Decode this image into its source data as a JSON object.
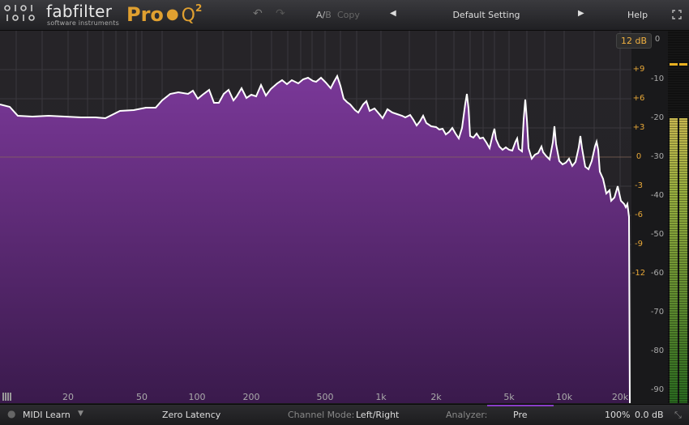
{
  "header": {
    "brand": "fabfilter",
    "brand_sub": "software instruments",
    "product": "Pro",
    "product_q": "Q",
    "product_version": "2",
    "ab_a": "A/",
    "ab_b": "B",
    "copy": "Copy",
    "preset_name": "Default Setting",
    "help": "Help",
    "undo_icon": "undo-icon",
    "redo_icon": "redo-icon",
    "prev_icon": "triangle-left-icon",
    "next_icon": "triangle-right-icon"
  },
  "display": {
    "range_button": "12 dB",
    "gain_scale": [
      "+9",
      "+6",
      "+3",
      "0",
      "-3",
      "-6",
      "-9",
      "-12"
    ],
    "db_scale": [
      "0",
      "-10",
      "-20",
      "-30",
      "-40",
      "-50",
      "-60",
      "-70",
      "-80",
      "-90"
    ],
    "freq_labels": [
      "20",
      "50",
      "100",
      "200",
      "500",
      "1k",
      "2k",
      "5k",
      "10k",
      "20k"
    ],
    "spectrum_color": "#6a2a86",
    "curve_color": "#ffffff",
    "accent_color": "#e8a838"
  },
  "footer": {
    "midi_learn": "MIDI Learn",
    "latency": "Zero Latency",
    "channel_mode_label": "Channel Mode:",
    "channel_mode_value": "Left/Right",
    "analyzer_label": "Analyzer:",
    "analyzer_value": "Pre",
    "zoom": "100%",
    "output_gain": "0.0 dB"
  }
}
